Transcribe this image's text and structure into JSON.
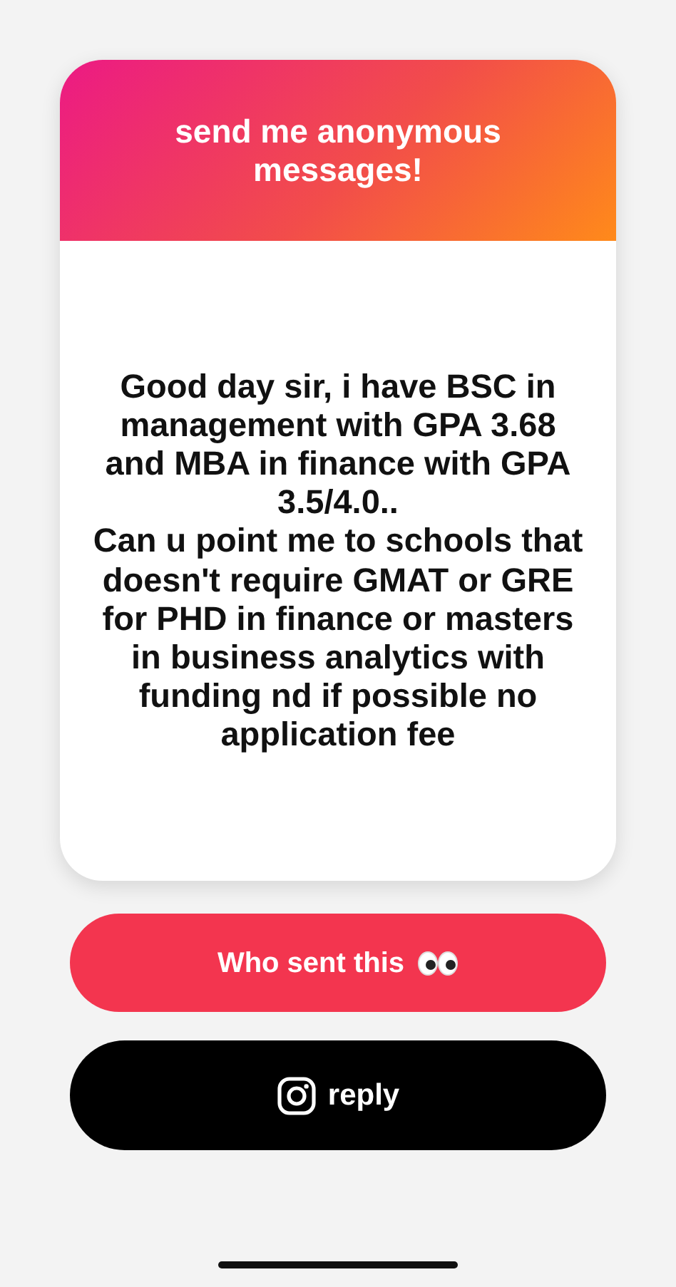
{
  "card": {
    "title": "send me anonymous messages!",
    "message": "Good day sir, i have BSC in management with GPA 3.68 and MBA in finance with GPA 3.5/4.0..\nCan u point me to schools that doesn't require GMAT or GRE for PHD in finance or masters in business analytics with funding nd if possible no application fee"
  },
  "buttons": [
    {
      "kind": "reveal",
      "label": "Who sent this"
    },
    {
      "kind": "reply",
      "label": "reply"
    }
  ]
}
